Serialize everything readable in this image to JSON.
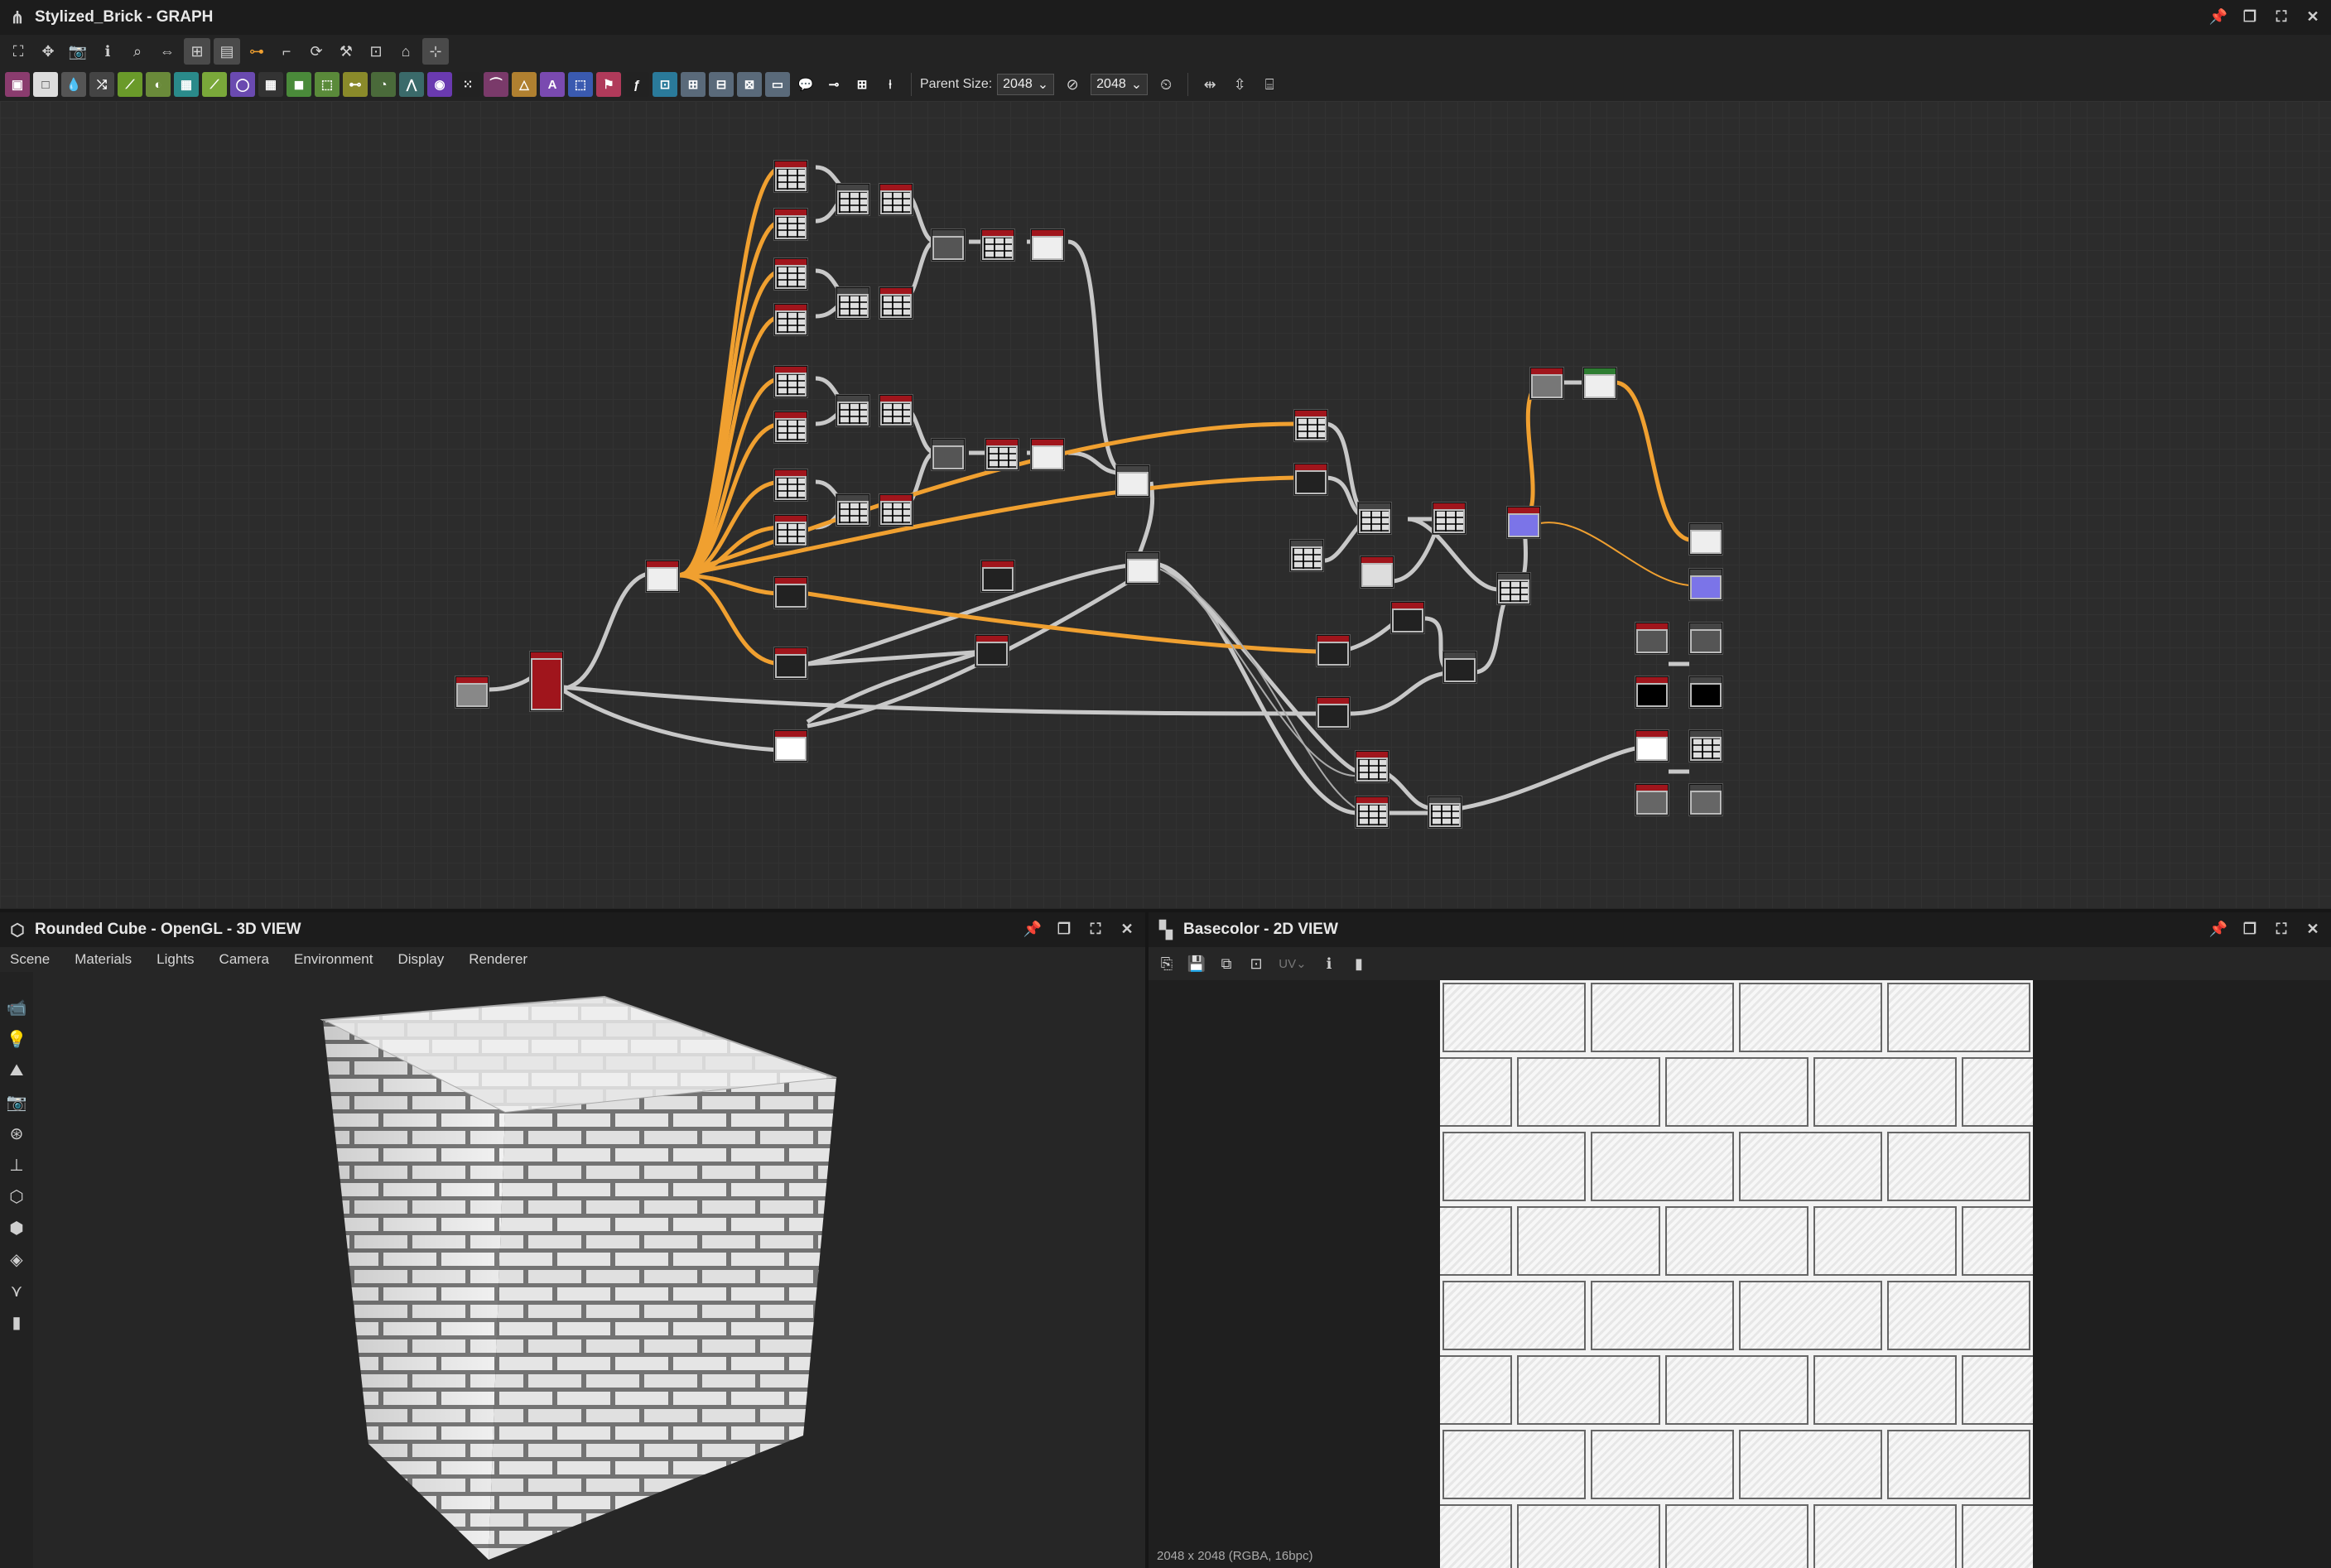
{
  "graph": {
    "title": "Stylized_Brick - GRAPH",
    "parent_size_label": "Parent Size:",
    "parent_size_value": "2048",
    "output_size_value": "2048"
  },
  "view3d": {
    "title": "Rounded Cube - OpenGL - 3D VIEW",
    "menu": [
      "Scene",
      "Materials",
      "Lights",
      "Camera",
      "Environment",
      "Display",
      "Renderer"
    ]
  },
  "view2d": {
    "title": "Basecolor - 2D VIEW",
    "uv_label": "UV",
    "status": "2048 x 2048 (RGBA, 16bpc)"
  },
  "colors": {
    "accent_link": "#f0a030",
    "node_header": "#a0151c",
    "output_header_green": "#2e7d32",
    "normal_purple": "#7b74e8"
  },
  "icons": {
    "window": [
      "pin-icon",
      "float-icon",
      "maximize-icon",
      "close-icon"
    ]
  }
}
